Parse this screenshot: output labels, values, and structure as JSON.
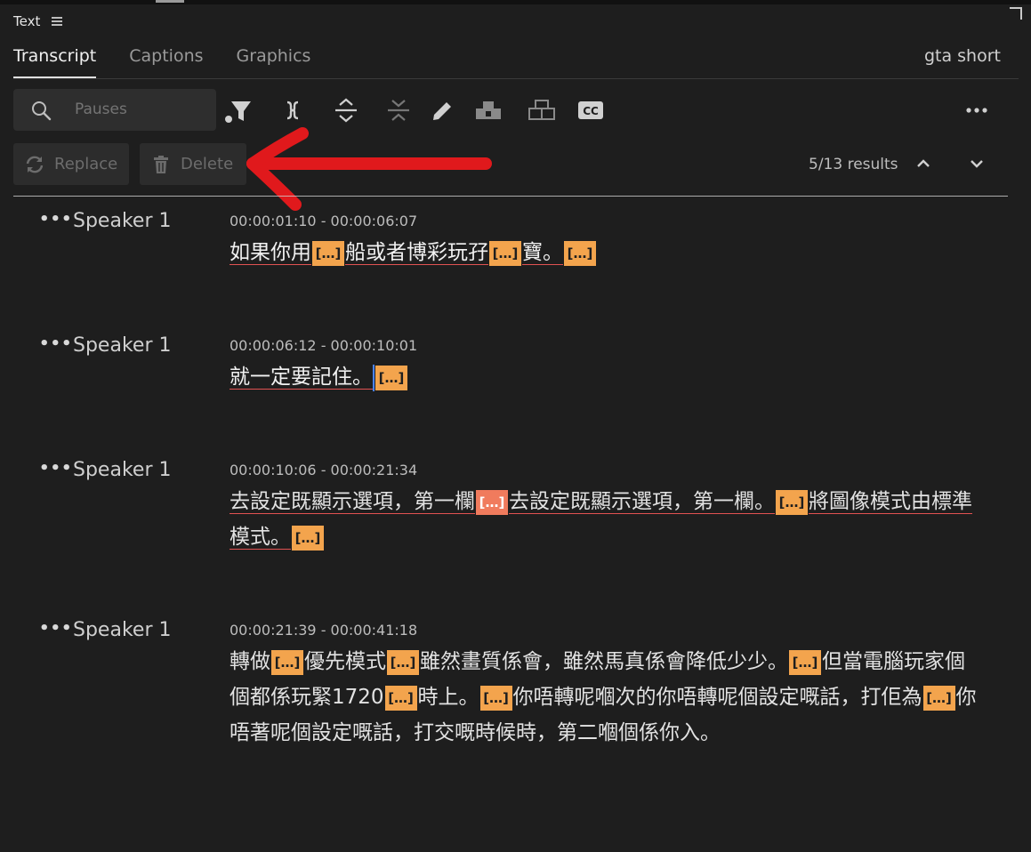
{
  "panel": {
    "title": "Text"
  },
  "tabs": [
    {
      "label": "Transcript",
      "active": true
    },
    {
      "label": "Captions",
      "active": false
    },
    {
      "label": "Graphics",
      "active": false
    }
  ],
  "sequence_name": "gta short",
  "search": {
    "placeholder": "Pauses"
  },
  "toolbar": {
    "icons": [
      "filter-icon",
      "merge-segments-icon",
      "expand-icon",
      "collapse-icon",
      "pencil-icon",
      "speaker-icon",
      "speaker-alt-icon",
      "cc-icon",
      "more-icon"
    ]
  },
  "actions": {
    "replace_label": "Replace",
    "delete_label": "Delete"
  },
  "results": {
    "text": "5/13 results"
  },
  "colors": {
    "pause_highlight": "#f3a44d",
    "pause_selected": "#f07b5d",
    "underline": "#e25252",
    "annotation_arrow": "#e0191c"
  },
  "segments": [
    {
      "speaker": "Speaker 1",
      "timecode": "00:00:01:10 - 00:00:06:07",
      "parts": [
        {
          "t": "如果你用"
        },
        {
          "p": "[…]"
        },
        {
          "t": "船或者博彩玩孖"
        },
        {
          "p": "[…]"
        },
        {
          "t": "寶。"
        },
        {
          "p": "[…]"
        }
      ]
    },
    {
      "speaker": "Speaker 1",
      "timecode": "00:00:06:12 - 00:00:10:01",
      "parts": [
        {
          "t": "就一定要記住。"
        },
        {
          "p": "[…]"
        }
      ]
    },
    {
      "speaker": "Speaker 1",
      "timecode": "00:00:10:06 - 00:00:21:34",
      "parts": [
        {
          "t": "去設定既顯示選項，第一欄"
        },
        {
          "p": "[…]",
          "sel": true
        },
        {
          "t": "去設定既顯示選項，第一欄。"
        },
        {
          "p": "[…]"
        },
        {
          "t": "將圖像模式由標準模式。"
        },
        {
          "p": "[…]"
        }
      ]
    },
    {
      "speaker": "Speaker 1",
      "timecode": "00:00:21:39 - 00:00:41:18",
      "parts": [
        {
          "t": "轉做"
        },
        {
          "p": "[…]"
        },
        {
          "t": "優先模式"
        },
        {
          "p": "[…]"
        },
        {
          "t": "雖然畫質係會，雖然馬真係會降低少少。"
        },
        {
          "p": "[…]"
        },
        {
          "t": "但當電腦玩家個個都係玩緊1720"
        },
        {
          "p": "[…]"
        },
        {
          "t": "時上。"
        },
        {
          "p": "[…]"
        },
        {
          "t": "你唔轉呢嗰次的你唔轉呢個設定嘅話，打佢為"
        },
        {
          "p": "[…]"
        },
        {
          "t": "你唔著呢個設定嘅話，打交嘅時候時，第二嗰個係你入。"
        }
      ]
    }
  ]
}
